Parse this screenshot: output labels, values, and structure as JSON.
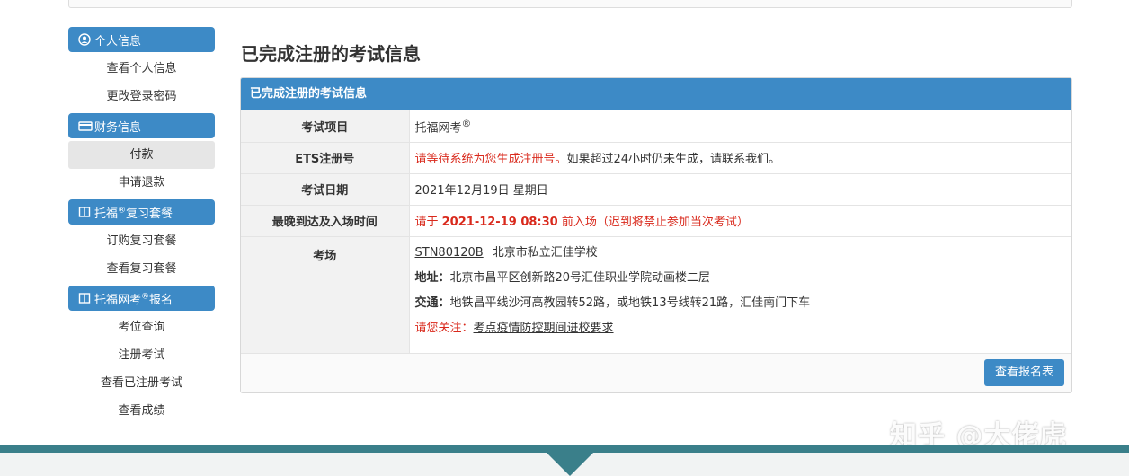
{
  "sidebar": {
    "sections": [
      {
        "title": "个人信息",
        "icon": "user-circle-icon",
        "items": [
          "查看个人信息",
          "更改登录密码"
        ]
      },
      {
        "title": "财务信息",
        "icon": "credit-card-icon",
        "items": [
          "付款",
          "申请退款"
        ]
      },
      {
        "title_pre": "托福",
        "title_sup": "®",
        "title_post": "复习套餐",
        "icon": "book-icon",
        "items": [
          "订购复习套餐",
          "查看复习套餐"
        ]
      },
      {
        "title_pre": "托福网考",
        "title_sup": "®",
        "title_post": "报名",
        "icon": "book-icon",
        "items": [
          "考位查询",
          "注册考试",
          "查看已注册考试",
          "查看成绩"
        ]
      }
    ],
    "active_item": "付款"
  },
  "page_title": "已完成注册的考试信息",
  "panel": {
    "header": "已完成注册的考试信息",
    "rows": {
      "exam_item": {
        "label": "考试项目",
        "value": "托福网考",
        "sup": "®"
      },
      "ets_id": {
        "label": "ETS注册号",
        "value_red": "请等待系统为您生成注册号。",
        "value_rest": "如果超过24小时仍未生成，请联系我们。"
      },
      "exam_date": {
        "label": "考试日期",
        "value": "2021年12月19日 星期日"
      },
      "arrival": {
        "label": "最晚到达及入场时间",
        "prefix": "请于 ",
        "time": "2021-12-19 08:30",
        "suffix": " 前入场（迟到将禁止参加当次考试）"
      },
      "venue": {
        "label": "考场",
        "code": "STN80120B",
        "name": "北京市私立汇佳学校",
        "address_label": "地址：",
        "address": "北京市昌平区创新路20号汇佳职业学院动画楼二层",
        "traffic_label": "交通：",
        "traffic": "地铁昌平线沙河高教园转52路，或地铁13号线转21路，汇佳南门下车",
        "notice_label": "请您关注：",
        "notice_link": "考点疫情防控期间进校要求"
      }
    },
    "button": "查看报名表"
  },
  "watermark": "知乎 @大佬虎",
  "colors": {
    "accent": "#3d8ac6",
    "alert": "#d9291c",
    "band": "#3a7f8a"
  }
}
